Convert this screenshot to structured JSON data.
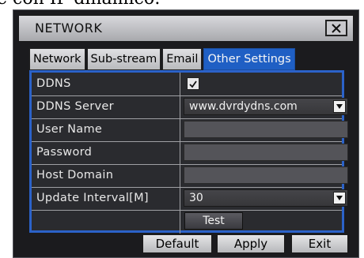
{
  "page_header_text": "e con IP dinamico:",
  "window": {
    "title": "NETWORK",
    "close_icon": "close-icon"
  },
  "tabs": [
    {
      "label": "Network",
      "active": false
    },
    {
      "label": "Sub-stream",
      "active": false
    },
    {
      "label": "Email",
      "active": false
    },
    {
      "label": "Other Settings",
      "active": true
    }
  ],
  "settings": {
    "ddns": {
      "label": "DDNS",
      "checked": true
    },
    "ddns_server": {
      "label": "DDNS Server",
      "value": "www.dvrdydns.com"
    },
    "user_name": {
      "label": "User Name",
      "value": ""
    },
    "password": {
      "label": "Password",
      "value": ""
    },
    "host_domain": {
      "label": "Host Domain",
      "value": ""
    },
    "update_interval": {
      "label": "Update Interval[M]",
      "value": "30"
    },
    "test_label": "Test"
  },
  "footer": {
    "default_label": "Default",
    "apply_label": "Apply",
    "exit_label": "Exit"
  },
  "colors": {
    "active_tab": "#1f5fc4",
    "panel_border": "#2b62c9",
    "background": "#1b1b1e"
  }
}
